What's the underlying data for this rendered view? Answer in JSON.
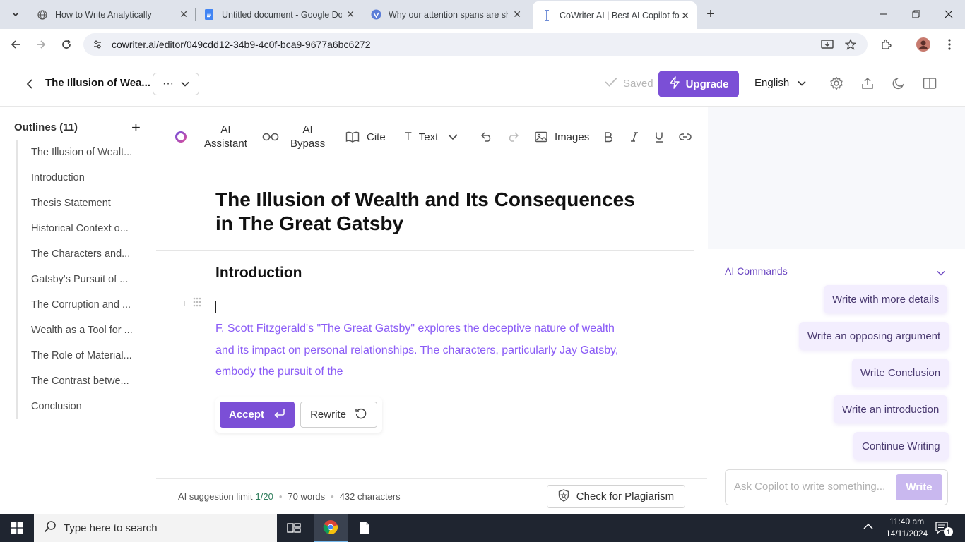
{
  "browser": {
    "tabs": [
      {
        "title": "How to Write Analytically",
        "icon": "globe-icon"
      },
      {
        "title": "Untitled document - Google Docs",
        "icon": "google-docs-icon"
      },
      {
        "title": "Why our attention spans are sh",
        "icon": "site-icon"
      },
      {
        "title": "CoWriter AI | Best AI Copilot for",
        "icon": "cowriter-icon"
      }
    ],
    "url": "cowriter.ai/editor/049cdd12-34b9-4c0f-bca9-9677a6bc6272"
  },
  "header": {
    "doc_title": "The Illusion of Wea...",
    "saved_label": "Saved",
    "upgrade_label": "Upgrade",
    "language": "English"
  },
  "sidebar": {
    "heading": "Outlines (11)",
    "items": [
      "The Illusion of Wealt...",
      "Introduction",
      "Thesis Statement",
      "Historical Context o...",
      "The Characters and...",
      "Gatsby's Pursuit of ...",
      "The Corruption and ...",
      "Wealth as a Tool for ...",
      "The Role of Material...",
      "The Contrast betwe...",
      "Conclusion"
    ]
  },
  "toolbar": {
    "ai_assistant_1": "AI",
    "ai_assistant_2": "Assistant",
    "ai_bypass_1": "AI",
    "ai_bypass_2": "Bypass",
    "cite": "Cite",
    "text": "Text",
    "images": "Images"
  },
  "document": {
    "title": "The Illusion of Wealth and Its Consequences in The Great Gatsby",
    "section_heading": "Introduction",
    "suggestion": " F. Scott Fitzgerald's \"The Great Gatsby\" explores the deceptive nature of wealth and its impact on personal relationships. The characters, particularly Jay Gatsby, embody the pursuit of the",
    "accept_label": "Accept",
    "rewrite_label": "Rewrite"
  },
  "footer": {
    "limit_label": "AI suggestion limit",
    "limit_value": "1/20",
    "words": "70 words",
    "characters": "432 characters",
    "plagiarism_label": "Check for Plagiarism"
  },
  "ai_commands": {
    "heading": "AI Commands",
    "items": [
      "Write with more details",
      "Write an opposing argument",
      "Write Conclusion",
      "Write an introduction",
      "Continue Writing"
    ],
    "ask_placeholder": "Ask Copilot to write something...",
    "write_label": "Write"
  },
  "taskbar": {
    "search_placeholder": "Type here to search",
    "time": "11:40 am",
    "date": "14/11/2024",
    "notification_count": "1"
  },
  "colors": {
    "accent": "#7b4fd6",
    "suggestion_text": "#8b5cf6",
    "command_bg": "#f3eefe"
  }
}
